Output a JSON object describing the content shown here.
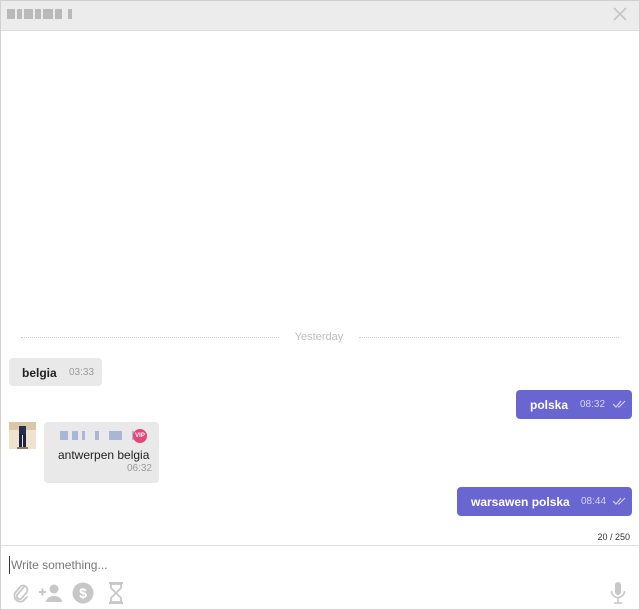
{
  "divider": {
    "label": "Yesterday"
  },
  "messages": [
    {
      "text": "belgia",
      "time": "03:33"
    },
    {
      "text": "polska",
      "time": "08:32"
    },
    {
      "text": "antwerpen belgia",
      "time": "06:32",
      "badge": "VIP"
    },
    {
      "text": "warsawen polska",
      "time": "08:44"
    }
  ],
  "counter": "20 / 250",
  "composer": {
    "placeholder": "Write something..."
  },
  "colors": {
    "outgoing": "#6966d1",
    "incoming": "#e9e9e9",
    "vip_badge": "#e8457a"
  },
  "icons": [
    "close-icon",
    "double-check-icon",
    "paperclip-icon",
    "add-user-icon",
    "dollar-icon",
    "hourglass-icon",
    "microphone-icon"
  ]
}
